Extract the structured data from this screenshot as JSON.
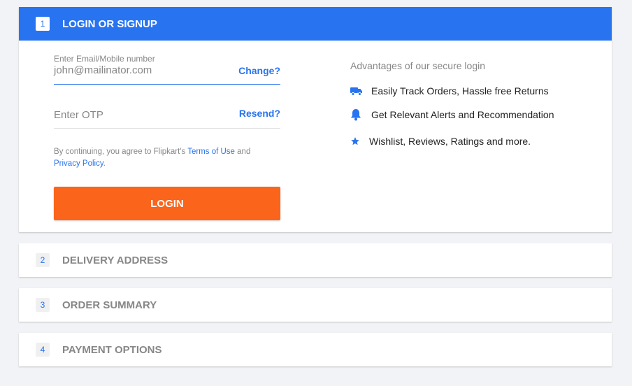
{
  "steps": [
    {
      "number": "1",
      "title": "LOGIN OR SIGNUP"
    },
    {
      "number": "2",
      "title": "DELIVERY ADDRESS"
    },
    {
      "number": "3",
      "title": "ORDER SUMMARY"
    },
    {
      "number": "4",
      "title": "PAYMENT OPTIONS"
    }
  ],
  "login": {
    "email_label": "Enter Email/Mobile number",
    "email_value": "john@mailinator.com",
    "change_label": "Change?",
    "otp_placeholder": "Enter OTP",
    "resend_label": "Resend?",
    "terms_prefix": "By continuing, you agree to Flipkart's ",
    "terms_link": "Terms of Use",
    "terms_and": " and",
    "privacy_link": "Privacy Policy",
    "terms_suffix": ".",
    "login_button": "LOGIN"
  },
  "advantages": {
    "title": "Advantages of our secure login",
    "items": [
      {
        "icon": "truck-icon",
        "text": "Easily Track Orders, Hassle free Returns"
      },
      {
        "icon": "bell-icon",
        "text": "Get Relevant Alerts and Recommendation"
      },
      {
        "icon": "star-icon",
        "text": "Wishlist, Reviews, Ratings and more."
      }
    ]
  },
  "colors": {
    "primary": "#2874f0",
    "login_button": "#fb641b",
    "background": "#f1f3f6"
  }
}
